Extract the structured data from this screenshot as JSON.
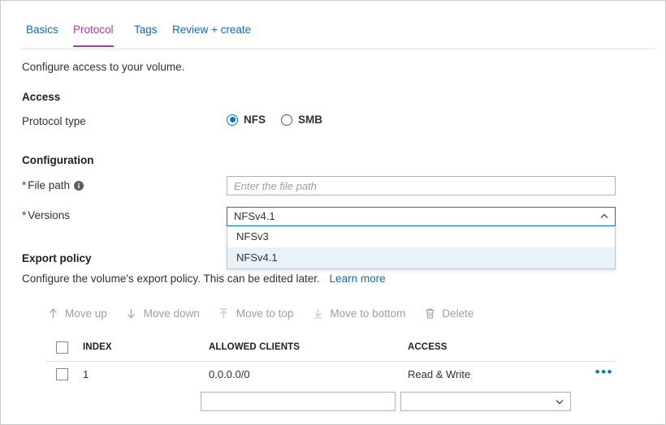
{
  "colors": {
    "link": "#0f6cbd",
    "active_tab": "#a33ea3",
    "accent": "#0078d4",
    "required_star": "#a4262c",
    "option_highlight": "#e8f2fb"
  },
  "tabs": [
    {
      "label": "Basics",
      "active": false
    },
    {
      "label": "Protocol",
      "active": true
    },
    {
      "label": "Tags",
      "active": false
    },
    {
      "label": "Review + create",
      "active": false
    }
  ],
  "page": {
    "description": "Configure access to your volume."
  },
  "access": {
    "heading": "Access",
    "protocol_type": {
      "label": "Protocol type",
      "options": [
        {
          "label": "NFS",
          "checked": true
        },
        {
          "label": "SMB",
          "checked": false
        }
      ]
    }
  },
  "configuration": {
    "heading": "Configuration",
    "file_path": {
      "label": "File path",
      "required_marker": "*",
      "info_glyph": "i",
      "value": "",
      "placeholder": "Enter the file path"
    },
    "versions": {
      "label": "Versions",
      "required_marker": "*",
      "value": "NFSv4.1",
      "expanded": true,
      "options": [
        {
          "label": "NFSv3",
          "selected": false
        },
        {
          "label": "NFSv4.1",
          "selected": true
        }
      ]
    }
  },
  "export_policy": {
    "heading": "Export policy",
    "description": "Configure the volume's export policy. This can be edited later.",
    "learn_more": "Learn more",
    "commands": [
      {
        "label": "Move up",
        "icon": "arrow-up-icon",
        "disabled": true
      },
      {
        "label": "Move down",
        "icon": "arrow-down-icon",
        "disabled": true
      },
      {
        "label": "Move to top",
        "icon": "arrow-to-top-icon",
        "disabled": true
      },
      {
        "label": "Move to bottom",
        "icon": "arrow-to-bottom-icon",
        "disabled": true
      },
      {
        "label": "Delete",
        "icon": "trash-icon",
        "disabled": true
      }
    ],
    "table": {
      "columns": [
        "INDEX",
        "ALLOWED CLIENTS",
        "ACCESS"
      ],
      "rows": [
        {
          "index": "1",
          "allowed_clients": "0.0.0.0/0",
          "access": "Read & Write",
          "more_glyph": "•••"
        }
      ]
    },
    "editor": {
      "allowed_clients_value": "",
      "access_value": ""
    }
  }
}
